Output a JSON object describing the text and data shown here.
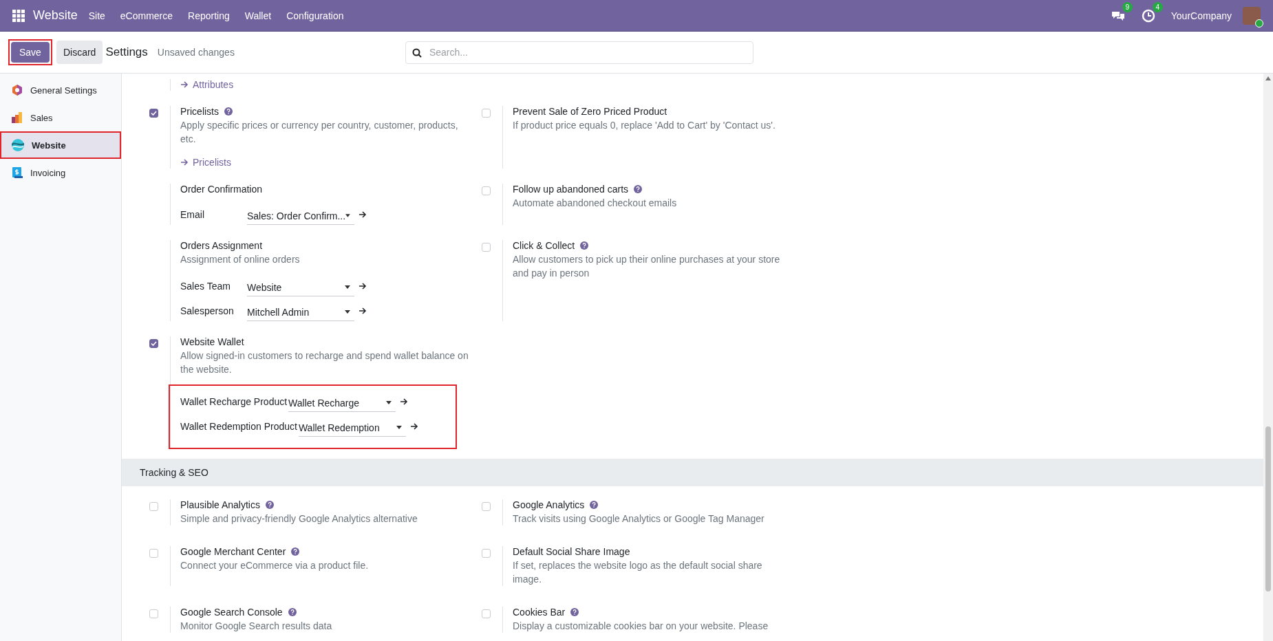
{
  "navbar": {
    "app": "Website",
    "menu": [
      "Site",
      "eCommerce",
      "Reporting",
      "Wallet",
      "Configuration"
    ],
    "messages_badge": "9",
    "activities_badge": "4",
    "company": "YourCompany"
  },
  "control_panel": {
    "save": {
      "label": "Save",
      "highlighted": true
    },
    "discard": "Discard",
    "title": "Settings",
    "status": "Unsaved changes",
    "search": {
      "placeholder": "Search..."
    }
  },
  "sidebar": {
    "items": [
      {
        "kind": "general",
        "label": "General Settings",
        "selected": false,
        "highlighted": false
      },
      {
        "kind": "sales",
        "label": "Sales",
        "selected": false,
        "highlighted": false
      },
      {
        "kind": "website",
        "label": "Website",
        "selected": true,
        "highlighted": true
      },
      {
        "kind": "invoicing",
        "label": "Invoicing",
        "selected": false,
        "highlighted": false
      }
    ]
  },
  "website_section": {
    "rows": [
      {
        "cells": [
          {
            "kind": "plain",
            "link": "Attributes"
          }
        ]
      },
      {
        "cells": [
          {
            "kind": "checkbox",
            "checked": true,
            "title": "Pricelists",
            "help": true,
            "description": "Apply specific prices or currency per country, customer, products, etc.",
            "link": "Pricelists"
          },
          {
            "kind": "checkbox",
            "checked": false,
            "title": "Prevent Sale of Zero Priced Product",
            "help": false,
            "description": "If product price equals 0, replace 'Add to Cart' by 'Contact us'."
          }
        ]
      },
      {
        "cells": [
          {
            "kind": "plain",
            "title": "Order Confirmation",
            "fields": {
              "highlighted": false,
              "items": [
                {
                  "label": "Email",
                  "value": "Sales: Order Confirm..."
                }
              ]
            }
          },
          {
            "kind": "checkbox",
            "checked": false,
            "title": "Follow up abandoned carts",
            "help": true,
            "description": "Automate abandoned checkout emails"
          }
        ]
      },
      {
        "cells": [
          {
            "kind": "plain",
            "title": "Orders Assignment",
            "description": "Assignment of online orders",
            "fields": {
              "highlighted": false,
              "items": [
                {
                  "label": "Sales Team",
                  "value": "Website"
                },
                {
                  "label": "Salesperson",
                  "value": "Mitchell Admin"
                }
              ]
            }
          },
          {
            "kind": "checkbox",
            "checked": false,
            "title": "Click & Collect",
            "help": true,
            "description": "Allow customers to pick up their online purchases at your store and pay in person"
          }
        ]
      },
      {
        "cells": [
          {
            "kind": "checkbox",
            "checked": true,
            "title": "Website Wallet",
            "help": false,
            "description": "Allow signed-in customers to recharge and spend wallet balance on the website.",
            "fields": {
              "highlighted": true,
              "items": [
                {
                  "label": "Wallet Recharge Product",
                  "value": "Wallet Recharge"
                },
                {
                  "label": "Wallet Redemption Product",
                  "value": "Wallet Redemption"
                }
              ]
            }
          }
        ]
      }
    ]
  },
  "tracking_section": {
    "title": "Tracking & SEO",
    "rows": [
      {
        "cells": [
          {
            "kind": "checkbox",
            "checked": false,
            "title": "Plausible Analytics",
            "help": true,
            "description": "Simple and privacy-friendly Google Analytics alternative"
          },
          {
            "kind": "checkbox",
            "checked": false,
            "title": "Google Analytics",
            "help": true,
            "description": "Track visits using Google Analytics or Google Tag Manager"
          }
        ]
      },
      {
        "cells": [
          {
            "kind": "checkbox",
            "checked": false,
            "title": "Google Merchant Center",
            "help": true,
            "description": "Connect your eCommerce via a product file."
          },
          {
            "kind": "checkbox",
            "checked": false,
            "title": "Default Social Share Image",
            "help": false,
            "description": "If set, replaces the website logo as the default social share image."
          }
        ]
      },
      {
        "cells": [
          {
            "kind": "checkbox",
            "checked": false,
            "title": "Google Search Console",
            "help": true,
            "description": "Monitor Google Search results data"
          },
          {
            "kind": "checkbox",
            "checked": false,
            "title": "Cookies Bar",
            "help": true,
            "description": "Display a customizable cookies bar on your website. Please"
          }
        ]
      }
    ]
  }
}
